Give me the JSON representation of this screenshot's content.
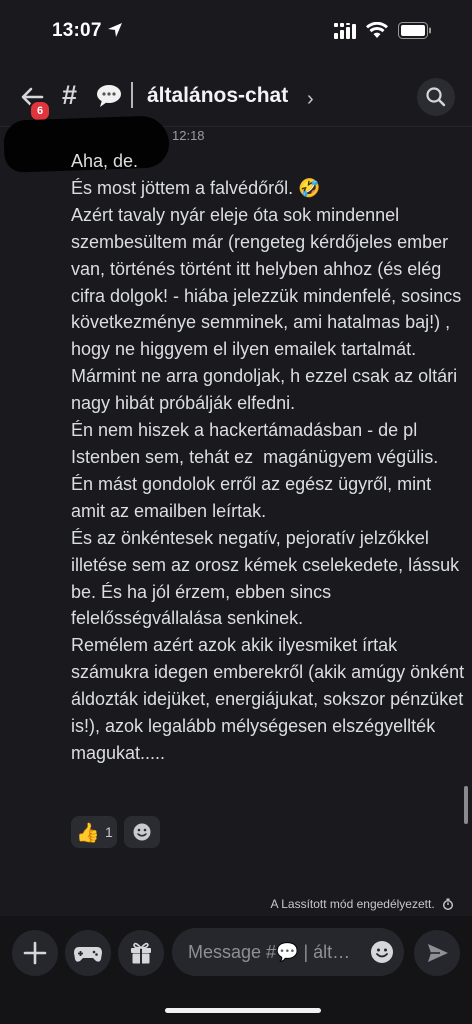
{
  "status_bar": {
    "time": "13:07"
  },
  "header": {
    "badge_count": "6",
    "hash": "#",
    "separator": "|",
    "channel_name": "általános-chat",
    "chevron": "›"
  },
  "message": {
    "time": "12:18",
    "text": "Aha, de.\nÉs most jöttem a falvédőről. 🤣\nAzért tavaly nyár eleje óta sok mindennel szembesültem már (rengeteg kérdőjeles ember van, történés történt itt helyben ahhoz (és elég cifra dolgok! - hiába jelezzük mindenfelé, sosincs következménye semminek, ami hatalmas baj!) , hogy ne higgyem el ilyen emailek tartalmát.\nMármint ne arra gondoljak, h ezzel csak az oltári nagy hibát próbálják elfedni.\nÉn nem hiszek a hackertámadásban - de pl Istenben sem, tehát ez  magánügyem végülis.\nÉn mást gondolok erről az egész ügyről, mint amit az emailben leírtak.\nÉs az önkéntesek negatív, pejoratív jelzőkkel illetése sem az orosz kémek cselekedete, lássuk be. És ha jól érzem, ebben sincs felelősségvállalása senkinek.\nRemélem azért azok akik ilyesmiket írtak számukra idegen emberekről (akik amúgy önként áldozták idejüket, energiájukat, sokszor pénzüket is!), azok legalább mélységesen elszégyellték magukat....."
  },
  "reactions": [
    {
      "emoji": "👍",
      "count": "1",
      "icon": "thumbs-up-icon"
    },
    {
      "icon": "add-reaction-icon"
    }
  ],
  "slowmode": {
    "text": "A Lassított mód engedélyezett."
  },
  "composer": {
    "placeholder": "Message #💬 | ált…"
  },
  "colors": {
    "background": "#1a1a1e",
    "badge": "#e0353c",
    "text": "#dbdee1",
    "muted": "#9a9ca2"
  }
}
